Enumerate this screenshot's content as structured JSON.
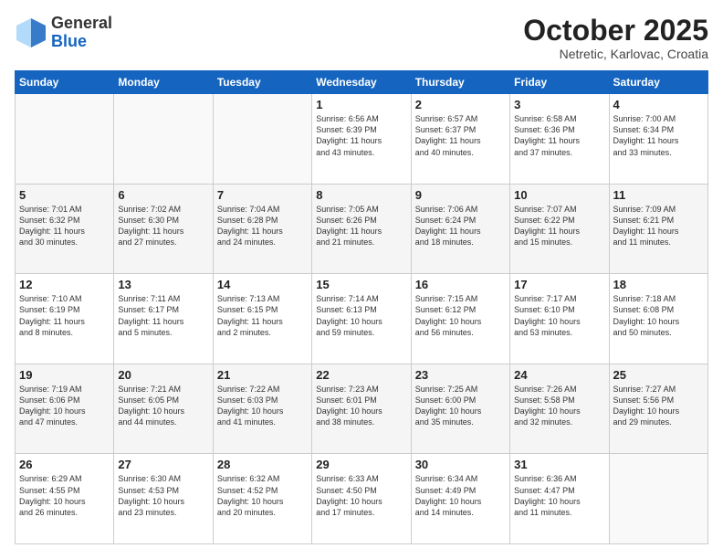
{
  "logo": {
    "general": "General",
    "blue": "Blue"
  },
  "header": {
    "month": "October 2025",
    "location": "Netretic, Karlovac, Croatia"
  },
  "weekdays": [
    "Sunday",
    "Monday",
    "Tuesday",
    "Wednesday",
    "Thursday",
    "Friday",
    "Saturday"
  ],
  "weeks": [
    [
      {
        "day": "",
        "info": ""
      },
      {
        "day": "",
        "info": ""
      },
      {
        "day": "",
        "info": ""
      },
      {
        "day": "1",
        "info": "Sunrise: 6:56 AM\nSunset: 6:39 PM\nDaylight: 11 hours\nand 43 minutes."
      },
      {
        "day": "2",
        "info": "Sunrise: 6:57 AM\nSunset: 6:37 PM\nDaylight: 11 hours\nand 40 minutes."
      },
      {
        "day": "3",
        "info": "Sunrise: 6:58 AM\nSunset: 6:36 PM\nDaylight: 11 hours\nand 37 minutes."
      },
      {
        "day": "4",
        "info": "Sunrise: 7:00 AM\nSunset: 6:34 PM\nDaylight: 11 hours\nand 33 minutes."
      }
    ],
    [
      {
        "day": "5",
        "info": "Sunrise: 7:01 AM\nSunset: 6:32 PM\nDaylight: 11 hours\nand 30 minutes."
      },
      {
        "day": "6",
        "info": "Sunrise: 7:02 AM\nSunset: 6:30 PM\nDaylight: 11 hours\nand 27 minutes."
      },
      {
        "day": "7",
        "info": "Sunrise: 7:04 AM\nSunset: 6:28 PM\nDaylight: 11 hours\nand 24 minutes."
      },
      {
        "day": "8",
        "info": "Sunrise: 7:05 AM\nSunset: 6:26 PM\nDaylight: 11 hours\nand 21 minutes."
      },
      {
        "day": "9",
        "info": "Sunrise: 7:06 AM\nSunset: 6:24 PM\nDaylight: 11 hours\nand 18 minutes."
      },
      {
        "day": "10",
        "info": "Sunrise: 7:07 AM\nSunset: 6:22 PM\nDaylight: 11 hours\nand 15 minutes."
      },
      {
        "day": "11",
        "info": "Sunrise: 7:09 AM\nSunset: 6:21 PM\nDaylight: 11 hours\nand 11 minutes."
      }
    ],
    [
      {
        "day": "12",
        "info": "Sunrise: 7:10 AM\nSunset: 6:19 PM\nDaylight: 11 hours\nand 8 minutes."
      },
      {
        "day": "13",
        "info": "Sunrise: 7:11 AM\nSunset: 6:17 PM\nDaylight: 11 hours\nand 5 minutes."
      },
      {
        "day": "14",
        "info": "Sunrise: 7:13 AM\nSunset: 6:15 PM\nDaylight: 11 hours\nand 2 minutes."
      },
      {
        "day": "15",
        "info": "Sunrise: 7:14 AM\nSunset: 6:13 PM\nDaylight: 10 hours\nand 59 minutes."
      },
      {
        "day": "16",
        "info": "Sunrise: 7:15 AM\nSunset: 6:12 PM\nDaylight: 10 hours\nand 56 minutes."
      },
      {
        "day": "17",
        "info": "Sunrise: 7:17 AM\nSunset: 6:10 PM\nDaylight: 10 hours\nand 53 minutes."
      },
      {
        "day": "18",
        "info": "Sunrise: 7:18 AM\nSunset: 6:08 PM\nDaylight: 10 hours\nand 50 minutes."
      }
    ],
    [
      {
        "day": "19",
        "info": "Sunrise: 7:19 AM\nSunset: 6:06 PM\nDaylight: 10 hours\nand 47 minutes."
      },
      {
        "day": "20",
        "info": "Sunrise: 7:21 AM\nSunset: 6:05 PM\nDaylight: 10 hours\nand 44 minutes."
      },
      {
        "day": "21",
        "info": "Sunrise: 7:22 AM\nSunset: 6:03 PM\nDaylight: 10 hours\nand 41 minutes."
      },
      {
        "day": "22",
        "info": "Sunrise: 7:23 AM\nSunset: 6:01 PM\nDaylight: 10 hours\nand 38 minutes."
      },
      {
        "day": "23",
        "info": "Sunrise: 7:25 AM\nSunset: 6:00 PM\nDaylight: 10 hours\nand 35 minutes."
      },
      {
        "day": "24",
        "info": "Sunrise: 7:26 AM\nSunset: 5:58 PM\nDaylight: 10 hours\nand 32 minutes."
      },
      {
        "day": "25",
        "info": "Sunrise: 7:27 AM\nSunset: 5:56 PM\nDaylight: 10 hours\nand 29 minutes."
      }
    ],
    [
      {
        "day": "26",
        "info": "Sunrise: 6:29 AM\nSunset: 4:55 PM\nDaylight: 10 hours\nand 26 minutes."
      },
      {
        "day": "27",
        "info": "Sunrise: 6:30 AM\nSunset: 4:53 PM\nDaylight: 10 hours\nand 23 minutes."
      },
      {
        "day": "28",
        "info": "Sunrise: 6:32 AM\nSunset: 4:52 PM\nDaylight: 10 hours\nand 20 minutes."
      },
      {
        "day": "29",
        "info": "Sunrise: 6:33 AM\nSunset: 4:50 PM\nDaylight: 10 hours\nand 17 minutes."
      },
      {
        "day": "30",
        "info": "Sunrise: 6:34 AM\nSunset: 4:49 PM\nDaylight: 10 hours\nand 14 minutes."
      },
      {
        "day": "31",
        "info": "Sunrise: 6:36 AM\nSunset: 4:47 PM\nDaylight: 10 hours\nand 11 minutes."
      },
      {
        "day": "",
        "info": ""
      }
    ]
  ]
}
